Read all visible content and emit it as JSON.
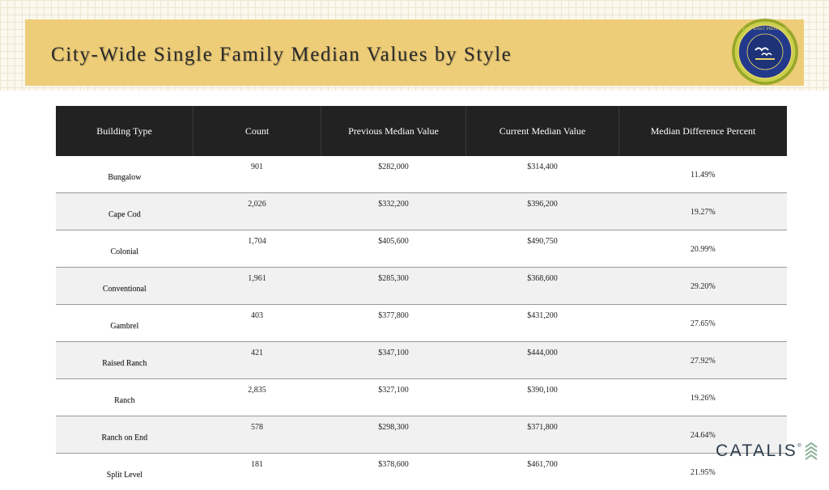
{
  "header": {
    "title": "City-Wide Single Family Median Values by Style",
    "seal_text": "CITY OF EAST PROVIDENCE",
    "accent_color": "#edcd78"
  },
  "table": {
    "columns": [
      "Building Type",
      "Count",
      "Previous Median Value",
      "Current Median Value",
      "Median Difference Percent"
    ],
    "rows": [
      {
        "type": "Bungalow",
        "count": "901",
        "previous": "$282,000",
        "current": "$314,400",
        "diff": "11.49%"
      },
      {
        "type": "Cape Cod",
        "count": "2,026",
        "previous": "$332,200",
        "current": "$396,200",
        "diff": "19.27%"
      },
      {
        "type": "Colonial",
        "count": "1,704",
        "previous": "$405,600",
        "current": "$490,750",
        "diff": "20.99%"
      },
      {
        "type": "Conventional",
        "count": "1,961",
        "previous": "$285,300",
        "current": "$368,600",
        "diff": "29.20%"
      },
      {
        "type": "Gambrel",
        "count": "403",
        "previous": "$377,800",
        "current": "$431,200",
        "diff": "27.65%"
      },
      {
        "type": "Raised Ranch",
        "count": "421",
        "previous": "$347,100",
        "current": "$444,000",
        "diff": "27.92%"
      },
      {
        "type": "Ranch",
        "count": "2,835",
        "previous": "$327,100",
        "current": "$390,100",
        "diff": "19.26%"
      },
      {
        "type": "Ranch on End",
        "count": "578",
        "previous": "$298,300",
        "current": "$371,800",
        "diff": "24.64%"
      },
      {
        "type": "Split Level",
        "count": "181",
        "previous": "$378,600",
        "current": "$461,700",
        "diff": "21.95%"
      }
    ]
  },
  "footer": {
    "logo_text": "CATALIS",
    "logo_tm": "®",
    "logo_icon": "stacked-chevrons-icon"
  }
}
